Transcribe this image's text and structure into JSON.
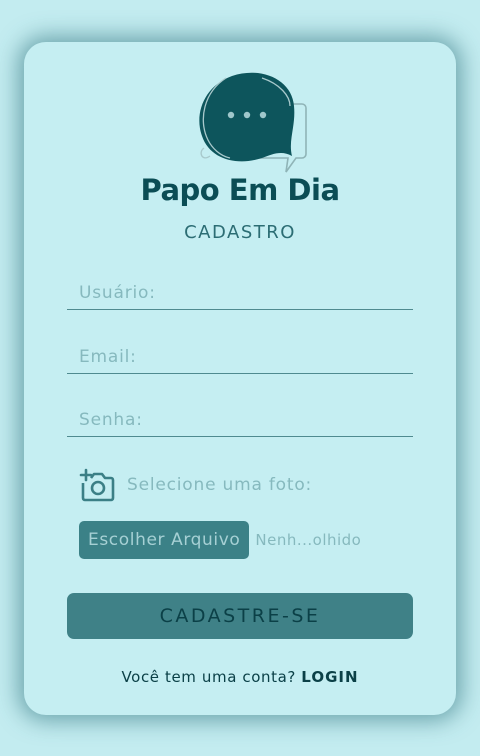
{
  "brand": {
    "name": "Papo Em Dia",
    "subtitle": "CADASTRO"
  },
  "form": {
    "username_placeholder": "Usuário:",
    "username_value": "",
    "email_placeholder": "Email:",
    "email_value": "",
    "password_placeholder": "Senha:",
    "password_value": "",
    "photo_label": "Selecione uma foto:",
    "photo_icon": "camera-add-icon",
    "file_button_label": "Escolher Arquivo",
    "file_status": "Nenh...olhido",
    "submit_label": "CADASTRE-SE"
  },
  "footer": {
    "prompt": "Você tem uma conta?",
    "login_label": "LOGIN"
  },
  "colors": {
    "background": "#c3ecf0",
    "card": "#c5eef2",
    "brand": "#0b4d55",
    "accent": "#3f8187",
    "muted": "#86b9be"
  }
}
